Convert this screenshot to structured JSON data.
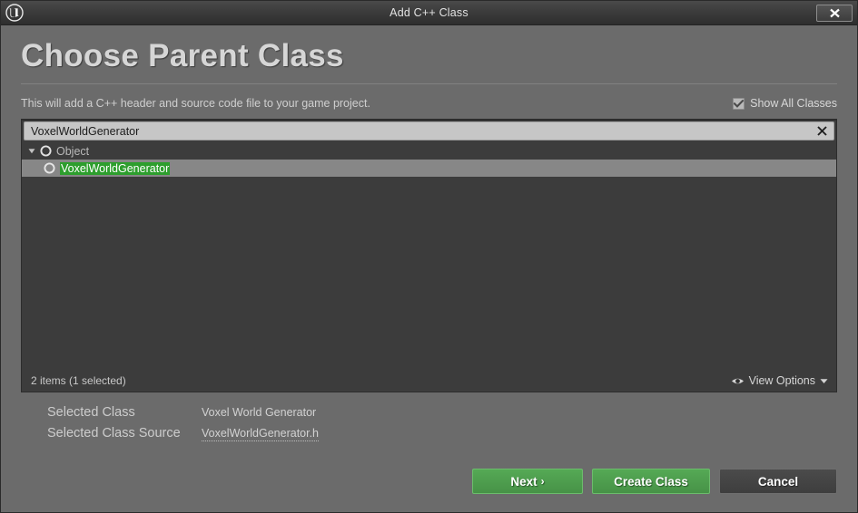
{
  "titlebar": {
    "logo_icon": "unreal-engine-logo",
    "title": "Add C++ Class",
    "close_icon": "close-icon",
    "close_label": "X"
  },
  "header": {
    "page_title": "Choose Parent Class",
    "subtitle": "This will add a C++ header and source code file to your game project.",
    "show_all_classes": {
      "label": "Show All Classes",
      "checked": true,
      "icon": "checkmark-icon"
    }
  },
  "search": {
    "value": "VoxelWorldGenerator",
    "placeholder": "Search Classes",
    "clear_icon": "clear-x-icon"
  },
  "tree": {
    "rows": [
      {
        "label": "Object",
        "indent": 0,
        "expanded": true,
        "selected": false,
        "highlighted": false,
        "twisty_icon": "expanded-triangle-icon",
        "class_icon": "class-circle-icon"
      },
      {
        "label": "VoxelWorldGenerator",
        "indent": 1,
        "expanded": false,
        "selected": true,
        "highlighted": true,
        "twisty_icon": "",
        "class_icon": "class-circle-icon"
      }
    ]
  },
  "panel_footer": {
    "item_count": "2 items (1 selected)",
    "view_options_label": "View Options",
    "eye_icon": "eye-icon",
    "caret_icon": "chevron-down-icon"
  },
  "selection": {
    "class_key": "Selected Class",
    "class_value": "Voxel World Generator",
    "source_key": "Selected Class Source",
    "source_value": "VoxelWorldGenerator.h"
  },
  "buttons": {
    "next": "Next",
    "next_chevron": "›",
    "create": "Create Class",
    "cancel": "Cancel"
  },
  "colors": {
    "accent_green": "#4a9a4a",
    "match_highlight": "#2d9e2d",
    "window_bg": "#6b6b6b",
    "panel_bg": "#3c3c3c",
    "selection_bg": "#878787"
  }
}
